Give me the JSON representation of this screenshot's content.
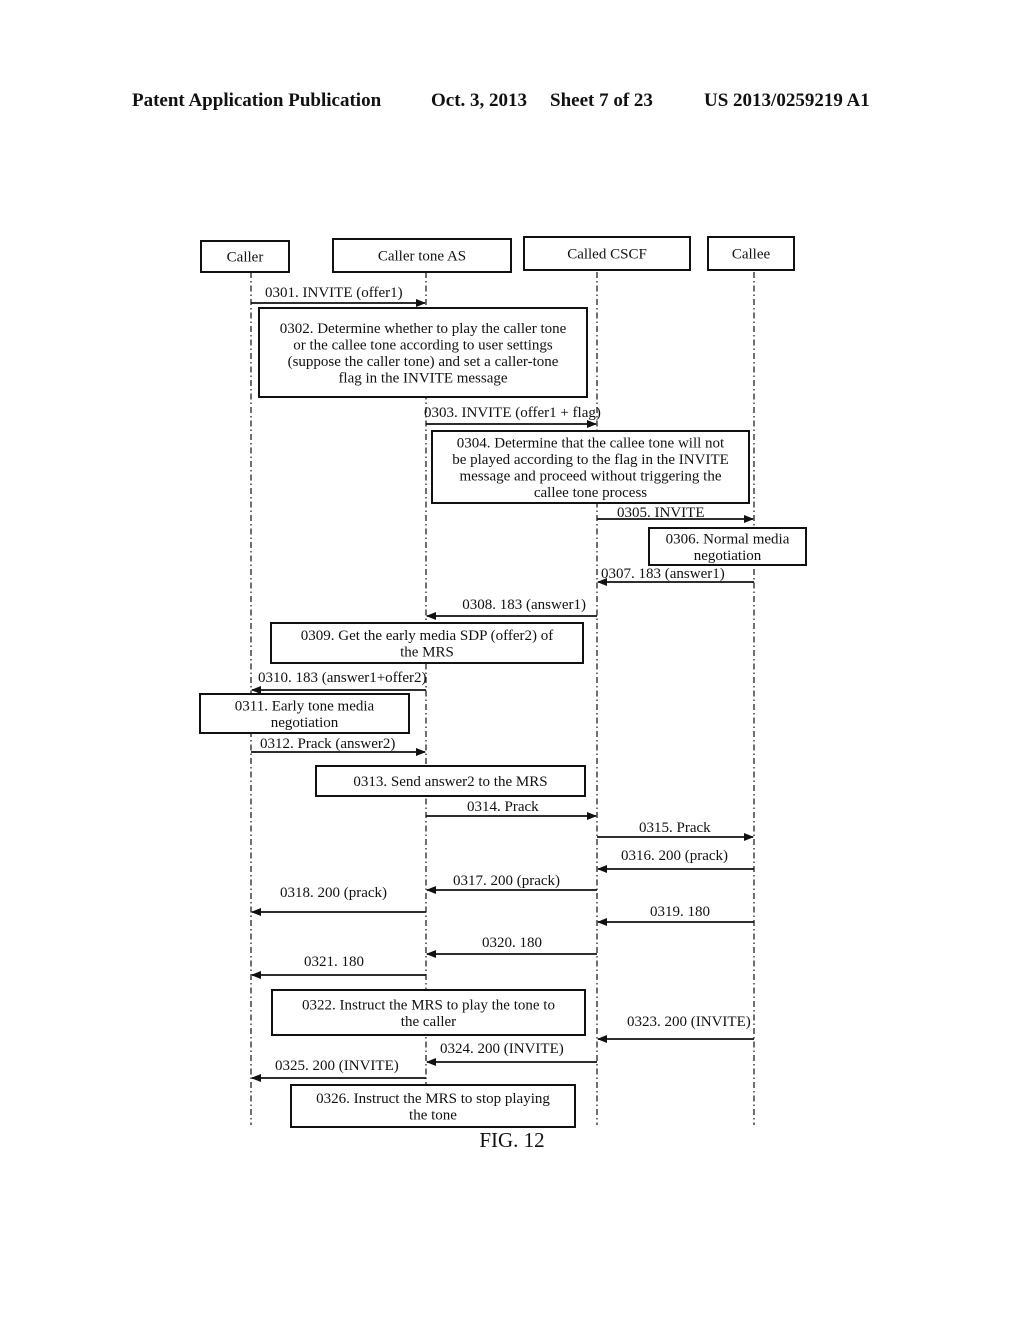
{
  "header": {
    "publication": "Patent Application Publication",
    "date": "Oct. 3, 2013",
    "sheet": "Sheet 7 of 23",
    "number": "US 2013/0259219 A1"
  },
  "participants": [
    {
      "id": "caller",
      "label": "Caller"
    },
    {
      "id": "as",
      "label": "Caller tone AS"
    },
    {
      "id": "cscf",
      "label": "Called CSCF"
    },
    {
      "id": "callee",
      "label": "Callee"
    }
  ],
  "steps": [
    {
      "type": "msg",
      "from": "caller",
      "to": "as",
      "label": "0301. INVITE (offer1)"
    },
    {
      "type": "box",
      "lines": [
        "0302. Determine whether to play the caller tone",
        "or the callee tone according to user settings",
        "(suppose the caller tone) and set a caller-tone",
        "flag in the INVITE message"
      ]
    },
    {
      "type": "msg",
      "from": "as",
      "to": "cscf",
      "label": "0303. INVITE (offer1 + flag)"
    },
    {
      "type": "box",
      "lines": [
        "0304. Determine that the callee tone will not",
        "be played according to the flag in the INVITE",
        "message and proceed without triggering the",
        "callee tone process"
      ]
    },
    {
      "type": "msg",
      "from": "cscf",
      "to": "callee",
      "label": "0305. INVITE"
    },
    {
      "type": "box",
      "lines": [
        "0306. Normal media",
        "negotiation"
      ]
    },
    {
      "type": "msg",
      "from": "callee",
      "to": "cscf",
      "label": "0307. 183 (answer1)"
    },
    {
      "type": "msg",
      "from": "cscf",
      "to": "as",
      "label": "0308. 183 (answer1)"
    },
    {
      "type": "box",
      "lines": [
        "0309. Get the early media SDP (offer2) of",
        "the MRS"
      ]
    },
    {
      "type": "msg",
      "from": "as",
      "to": "caller",
      "label": "0310. 183 (answer1+offer2)"
    },
    {
      "type": "box",
      "lines": [
        "0311. Early tone media",
        "negotiation"
      ]
    },
    {
      "type": "msg",
      "from": "caller",
      "to": "as",
      "label": "0312.  Prack (answer2)"
    },
    {
      "type": "box",
      "lines": [
        "0313. Send answer2 to the MRS"
      ]
    },
    {
      "type": "msg",
      "from": "as",
      "to": "cscf",
      "label": "0314. Prack"
    },
    {
      "type": "msg",
      "from": "cscf",
      "to": "callee",
      "label": "0315. Prack"
    },
    {
      "type": "msg",
      "from": "callee",
      "to": "cscf",
      "label": "0316. 200 (prack)"
    },
    {
      "type": "msg",
      "from": "cscf",
      "to": "as",
      "label": "0317. 200 (prack)"
    },
    {
      "type": "msg",
      "from": "as",
      "to": "caller",
      "label": "0318. 200 (prack)"
    },
    {
      "type": "msg",
      "from": "callee",
      "to": "cscf",
      "label": "0319. 180"
    },
    {
      "type": "msg",
      "from": "cscf",
      "to": "as",
      "label": "0320. 180"
    },
    {
      "type": "msg",
      "from": "as",
      "to": "caller",
      "label": "0321. 180"
    },
    {
      "type": "box",
      "lines": [
        "0322. Instruct the MRS to play the tone to",
        "the caller"
      ]
    },
    {
      "type": "msg",
      "from": "callee",
      "to": "cscf",
      "label": "0323. 200 (INVITE)"
    },
    {
      "type": "msg",
      "from": "cscf",
      "to": "as",
      "label": "0324. 200 (INVITE)"
    },
    {
      "type": "msg",
      "from": "as",
      "to": "caller",
      "label": "0325. 200 (INVITE)"
    },
    {
      "type": "box",
      "lines": [
        "0326. Instruct the MRS to stop playing",
        "the tone"
      ]
    }
  ],
  "caption": "FIG. 12"
}
